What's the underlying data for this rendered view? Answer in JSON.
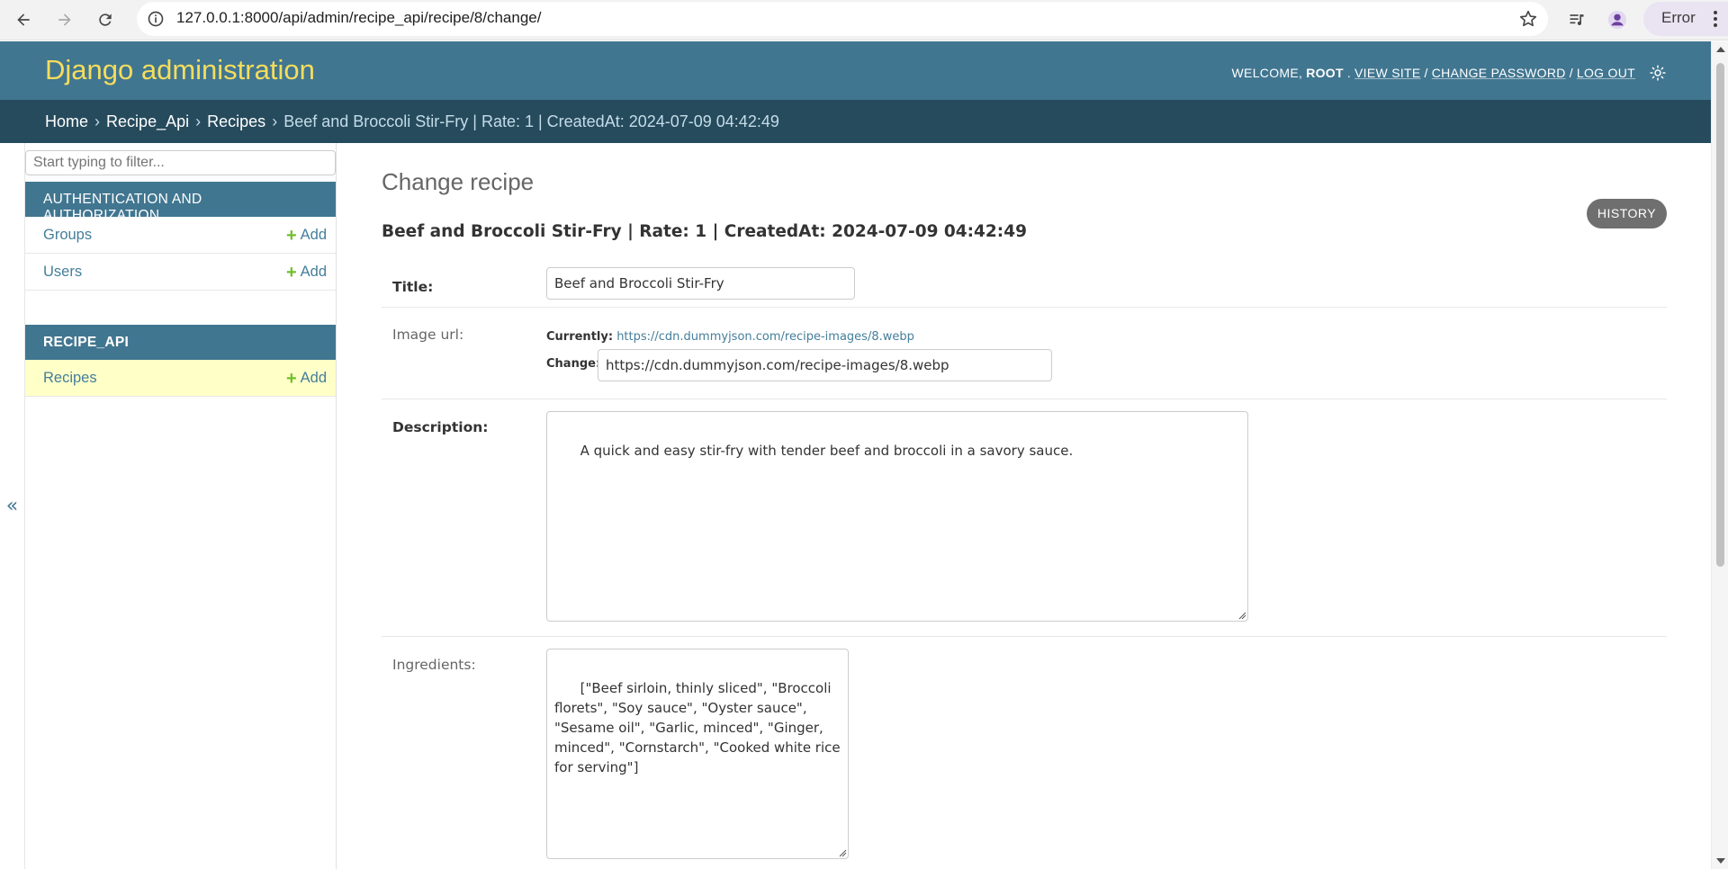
{
  "browser": {
    "url": "127.0.0.1:8000/api/admin/recipe_api/recipe/8/change/",
    "profile_status": "Error",
    "icons": [
      "back-icon",
      "forward-icon",
      "reload-icon",
      "site-info-icon",
      "bookmark-star-icon",
      "media-control-icon",
      "profile-icon",
      "more-vert-icon"
    ]
  },
  "header": {
    "branding": "Django administration",
    "welcome": "WELCOME,",
    "username": "ROOT",
    "view_site": "VIEW SITE",
    "change_password": "CHANGE PASSWORD",
    "log_out": "LOG OUT",
    "separator": "/"
  },
  "breadcrumbs": {
    "home": "Home",
    "app": "Recipe_Api",
    "model": "Recipes",
    "current": "Beef and Broccoli Stir-Fry | Rate: 1 | CreatedAt: 2024-07-09 04:42:49",
    "separator": "›"
  },
  "sidebar": {
    "filter_placeholder": "Start typing to filter...",
    "collapse_label": "«",
    "apps": [
      {
        "caption": "AUTHENTICATION AND AUTHORIZATION",
        "models": [
          {
            "name": "Groups",
            "add": "Add"
          },
          {
            "name": "Users",
            "add": "Add"
          }
        ]
      },
      {
        "caption": "RECIPE_API",
        "models": [
          {
            "name": "Recipes",
            "add": "Add",
            "active": true
          }
        ]
      }
    ]
  },
  "main": {
    "page_title": "Change recipe",
    "history_button": "HISTORY",
    "object_heading": "Beef and Broccoli Stir-Fry | Rate: 1 | CreatedAt: 2024-07-09 04:42:49",
    "fields": {
      "title": {
        "label": "Title:",
        "value": "Beef and Broccoli Stir-Fry"
      },
      "image_url": {
        "label": "Image url:",
        "currently_label": "Currently:",
        "currently_link": "https://cdn.dummyjson.com/recipe-images/8.webp",
        "change_label": "Change:",
        "value": "https://cdn.dummyjson.com/recipe-images/8.webp"
      },
      "description": {
        "label": "Description:",
        "value": "A quick and easy stir-fry with tender beef and broccoli in a savory sauce."
      },
      "ingredients": {
        "label": "Ingredients:",
        "value": "[\"Beef sirloin, thinly sliced\", \"Broccoli florets\", \"Soy sauce\", \"Oyster sauce\", \"Sesame oil\", \"Garlic, minced\", \"Ginger, minced\", \"Cornstarch\", \"Cooked white rice for serving\"]"
      }
    }
  },
  "colors": {
    "header_bg": "#417690",
    "branding": "#f5dd5d",
    "breadcrumbs_bg": "#264b5d",
    "link": "#447e9b",
    "add_plus": "#70bf2b",
    "active_row": "#ffffc8"
  }
}
